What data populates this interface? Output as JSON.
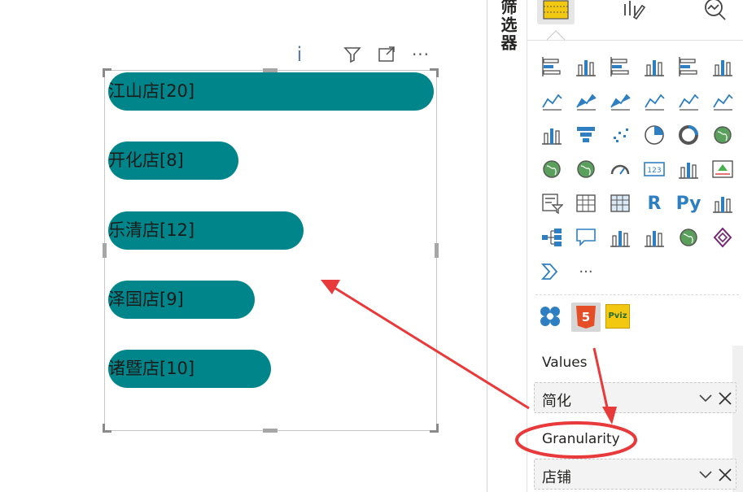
{
  "canvas": {
    "bars": [
      {
        "label": "江山店[20]",
        "value": 20
      },
      {
        "label": "开化店[8]",
        "value": 8
      },
      {
        "label": "乐清店[12]",
        "value": 12
      },
      {
        "label": "泽国店[9]",
        "value": 9
      },
      {
        "label": "诸暨店[10]",
        "value": 10
      }
    ],
    "bar_color": "#00868a",
    "header_icons": [
      "info-icon",
      "filter-icon",
      "focus-mode-icon",
      "more-options-icon"
    ]
  },
  "filter_pane": {
    "label": "筛选器"
  },
  "viz_pane": {
    "tabs": [
      "build-visual-icon",
      "format-visual-icon",
      "analytics-icon"
    ],
    "gallery_icons": [
      "stacked-bar-chart-icon",
      "stacked-column-chart-icon",
      "clustered-bar-chart-icon",
      "clustered-column-chart-icon",
      "100-stacked-bar-chart-icon",
      "100-stacked-column-chart-icon",
      "line-chart-icon",
      "area-chart-icon",
      "stacked-area-chart-icon",
      "line-and-column-chart-icon",
      "line-and-clustered-column-icon",
      "ribbon-chart-icon",
      "waterfall-chart-icon",
      "funnel-chart-icon",
      "scatter-chart-icon",
      "pie-chart-icon",
      "donut-chart-icon",
      "treemap-icon",
      "map-icon",
      "filled-map-icon",
      "gauge-icon",
      "card-icon",
      "multi-row-card-icon",
      "kpi-icon",
      "slicer-icon",
      "table-icon",
      "matrix-icon",
      "r-visual-icon",
      "python-visual-icon",
      "key-influencers-icon",
      "decomposition-tree-icon",
      "qa-icon",
      "smart-narrative-icon",
      "paginated-report-icon",
      "arcgis-map-icon",
      "power-apps-icon",
      "power-automate-icon",
      "more-visuals-icon"
    ],
    "r_text": "R",
    "py_text": "Py",
    "more_text": "···",
    "custom_visuals": [
      "custom-visual-icon",
      "html5-visual-icon",
      "pbiviz-icon"
    ],
    "html5_text": "5",
    "pbiviz_text": "Pviz",
    "wells": [
      {
        "label": "Values",
        "field": "简化"
      },
      {
        "label": "Granularity",
        "field": "店铺"
      }
    ]
  },
  "annotation": {
    "color": "#e8393b"
  }
}
